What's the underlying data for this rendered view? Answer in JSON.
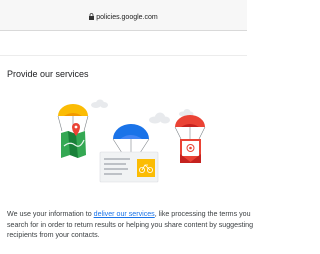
{
  "browser": {
    "url": "policies.google.com",
    "lock_icon": "lock-icon"
  },
  "section": {
    "heading": "Provide our services",
    "paragraph_before_link": "We use your information to ",
    "link_text": "deliver our services",
    "paragraph_after_link": ", like processing the terms you search for in order to return results or helping you share content by suggesting recipients from your contacts."
  },
  "illustration": {
    "icons": [
      "cloud-icon",
      "parachute-icon",
      "map-icon",
      "location-pin-icon",
      "document-icon",
      "bike-icon",
      "email-icon"
    ],
    "colors": {
      "yellow": "#fbbc04",
      "blue": "#1a73e8",
      "red": "#ea4335",
      "green": "#34a853",
      "cloud": "#e8eaed"
    }
  }
}
